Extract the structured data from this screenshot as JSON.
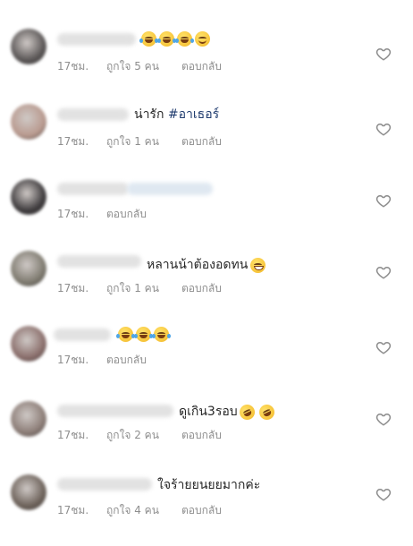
{
  "comments": [
    {
      "avatar_color": "#5a5656",
      "text": "",
      "emojis": [
        "tear",
        "tear",
        "tear",
        "smile"
      ],
      "time": "17ชม.",
      "likes": "ถูกใจ 5 คน",
      "reply": "ตอบกลับ"
    },
    {
      "avatar_color": "#b99a8f",
      "text": "น่ารัก",
      "hashtag": "#อาเธอร์",
      "emojis": [],
      "time": "17ชม.",
      "likes": "ถูกใจ 1 คน",
      "reply": "ตอบกลับ"
    },
    {
      "avatar_color": "#3e3b3d",
      "text": "",
      "emojis": [],
      "time": "17ชม.",
      "likes": "",
      "reply": "ตอบกลับ"
    },
    {
      "avatar_color": "#7f7b70",
      "text": "หลานน้าต้องอดทน",
      "emojis": [
        "grin"
      ],
      "time": "17ชม.",
      "likes": "ถูกใจ 1 คน",
      "reply": "ตอบกลับ"
    },
    {
      "avatar_color": "#8b6f6c",
      "text": "",
      "emojis": [
        "tear",
        "tear",
        "tear"
      ],
      "time": "17ชม.",
      "likes": "",
      "reply": "ตอบกลับ"
    },
    {
      "avatar_color": "#8c7d77",
      "text": "ดูเกิน3รอบ",
      "emojis": [
        "rofl",
        "rofl"
      ],
      "time": "17ชม.",
      "likes": "ถูกใจ 2 คน",
      "reply": "ตอบกลับ"
    },
    {
      "avatar_color": "#6d625a",
      "text": "ใจร้ายยนยยมากค่ะ",
      "emojis": [],
      "time": "17ชม.",
      "likes": "ถูกใจ 4 คน",
      "reply": "ตอบกลับ"
    }
  ],
  "icons": {
    "heart": "heart-outline-icon",
    "emoji": "emoji-icon"
  },
  "colors": {
    "text": "#262626",
    "meta": "#8e8e8e",
    "hashtag": "#1f3b6e",
    "heart": "#8e8e8e"
  }
}
